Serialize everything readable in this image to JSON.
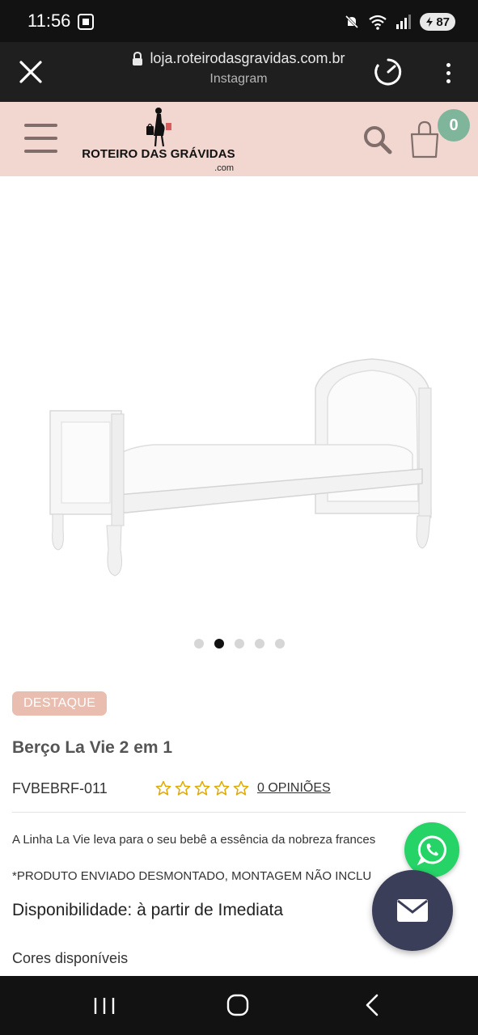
{
  "status_bar": {
    "time": "11:56",
    "battery_level": "87",
    "icons": [
      "screenshot-icon",
      "mute-icon",
      "wifi-icon",
      "signal-icon",
      "battery-icon"
    ]
  },
  "browser": {
    "url": "loja.roteirodasgravidas.com.br",
    "source": "Instagram",
    "icons": [
      "close-icon",
      "lock-icon",
      "speed-icon",
      "more-vert-icon"
    ]
  },
  "header": {
    "logo_name": "ROTEIRO DAS GRÁVIDAS",
    "logo_suffix": ".com",
    "cart_count": "0",
    "brand_color": "#f1d7d0",
    "accent_color": "#7fb59a",
    "icons": [
      "menu-icon",
      "search-icon",
      "cart-icon"
    ]
  },
  "gallery": {
    "slide_count": 5,
    "active_slide": 2,
    "image": "white-bed-icon"
  },
  "product": {
    "badge": "DESTAQUE",
    "title": "Berço La Vie 2 em 1",
    "sku": "FVBEBRF-011",
    "rating_stars": 0,
    "rating_max": 5,
    "reviews_link": "0 OPINIÕES",
    "description": "A Linha La Vie leva para o seu bebê a essência da nobreza frances",
    "note": "*PRODUTO ENVIADO DESMONTADO, MONTAGEM NÃO INCLU",
    "availability": "Disponibilidade: à partir de Imediata",
    "colors_label": "Cores disponíveis"
  },
  "floating": {
    "icons": [
      "whatsapp-icon",
      "mail-icon"
    ]
  },
  "nav": {
    "icons": [
      "recent-apps-icon",
      "home-icon",
      "back-icon"
    ]
  }
}
